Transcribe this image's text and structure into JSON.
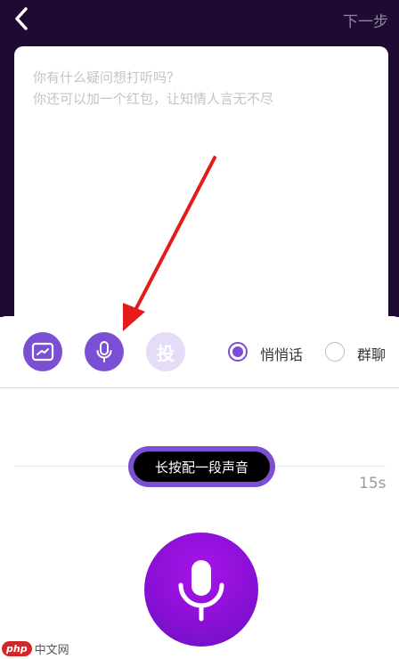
{
  "header": {
    "next_label": "下一步"
  },
  "compose": {
    "placeholder_line1": "你有什么疑问想打听吗？",
    "placeholder_line2": "你还可以加一个红包，让知情人言无不尽"
  },
  "toolbar": {
    "vote_label": "投",
    "visibility_options": [
      {
        "label": "悄悄话",
        "selected": true
      },
      {
        "label": "群聊",
        "selected": false
      }
    ]
  },
  "recorder": {
    "hint": "长按配一段声音",
    "max_duration": "15s"
  },
  "watermark": {
    "logo": "php",
    "text": "中文网"
  },
  "colors": {
    "accent": "#7b4fd3",
    "header_bg": "#1e0a33",
    "record_button": "#8a10d6",
    "annotation_arrow": "#e31b1b"
  },
  "icons": {
    "back": "chevron-left-icon",
    "image": "image-icon",
    "microphone": "microphone-icon"
  }
}
